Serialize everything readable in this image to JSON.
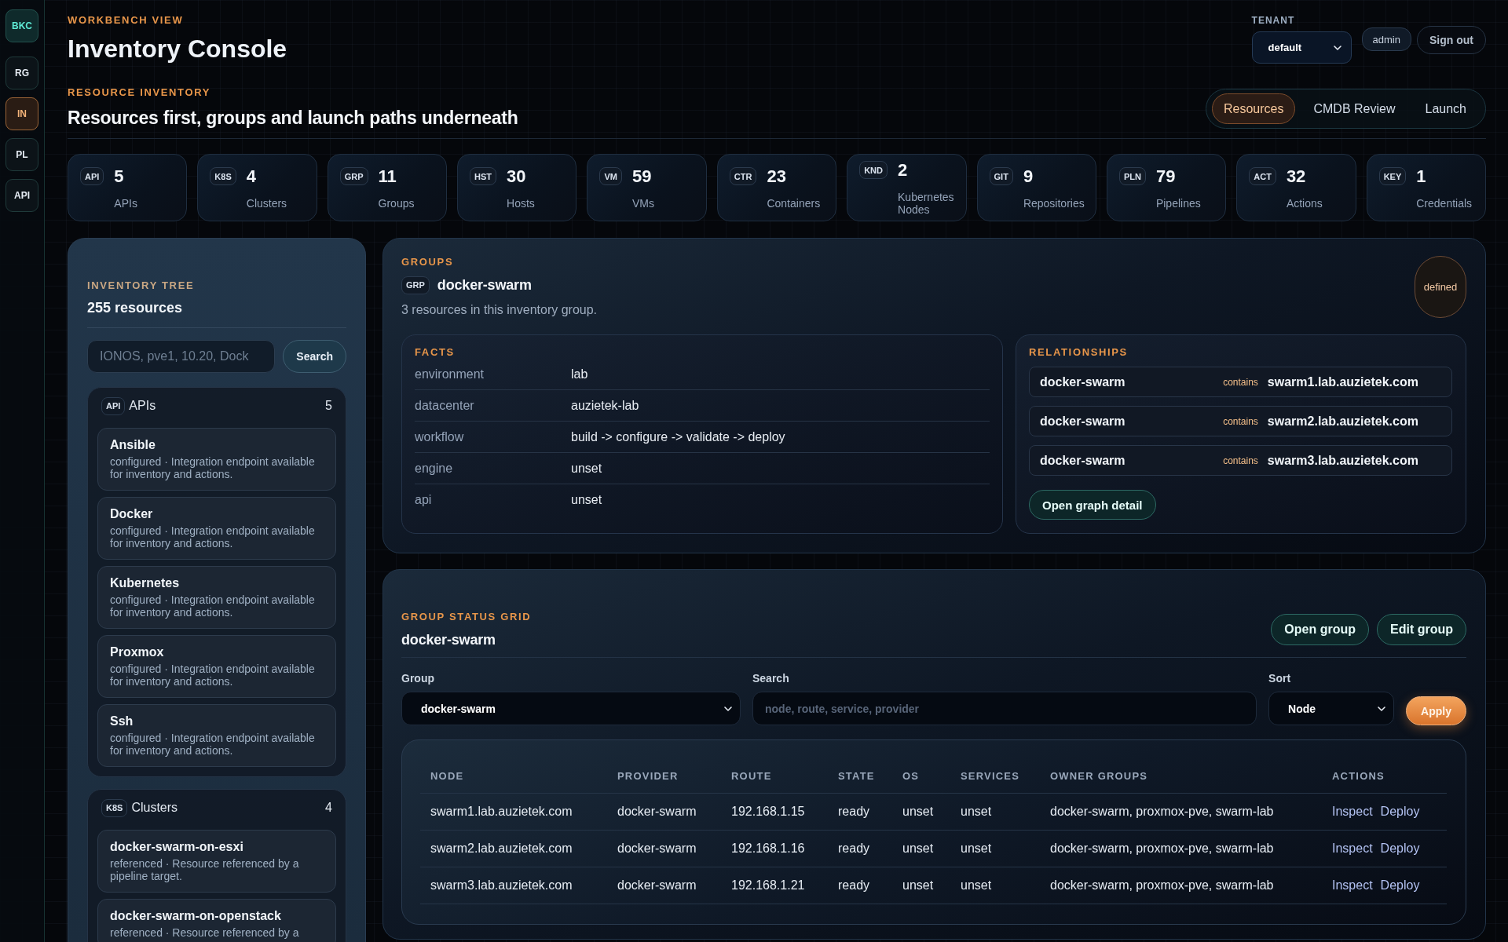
{
  "sidebar": {
    "logo": "BKC",
    "items": [
      {
        "label": "RG",
        "selected": false
      },
      {
        "label": "IN",
        "selected": true
      },
      {
        "label": "PL",
        "selected": false
      },
      {
        "label": "API",
        "selected": false
      }
    ]
  },
  "header": {
    "eyebrow": "WORKBENCH VIEW",
    "title": "Inventory Console"
  },
  "account": {
    "tenant_label": "TENANT",
    "tenant": "default",
    "user": "admin",
    "sign_out": "Sign out"
  },
  "section": {
    "eyebrow": "RESOURCE INVENTORY",
    "title": "Resources first, groups and launch paths underneath"
  },
  "tabs": [
    {
      "label": "Resources",
      "selected": true
    },
    {
      "label": "CMDB Review",
      "selected": false
    },
    {
      "label": "Launch",
      "selected": false
    }
  ],
  "stats": [
    {
      "badge": "API",
      "value": "5",
      "label": "APIs"
    },
    {
      "badge": "K8S",
      "value": "4",
      "label": "Clusters"
    },
    {
      "badge": "GRP",
      "value": "11",
      "label": "Groups"
    },
    {
      "badge": "HST",
      "value": "30",
      "label": "Hosts"
    },
    {
      "badge": "VM",
      "value": "59",
      "label": "VMs"
    },
    {
      "badge": "CTR",
      "value": "23",
      "label": "Containers"
    },
    {
      "badge": "KND",
      "value": "2",
      "label": "Kubernetes Nodes"
    },
    {
      "badge": "GIT",
      "value": "9",
      "label": "Repositories"
    },
    {
      "badge": "PLN",
      "value": "79",
      "label": "Pipelines"
    },
    {
      "badge": "ACT",
      "value": "32",
      "label": "Actions"
    },
    {
      "badge": "KEY",
      "value": "1",
      "label": "Credentials"
    }
  ],
  "inventory_tree": {
    "eyebrow": "INVENTORY TREE",
    "title": "255 resources",
    "search": {
      "placeholder": "IONOS, pve1, 10.20, Dock"
    },
    "search_button": "Search",
    "groups": [
      {
        "badge": "API",
        "name": "APIs",
        "count": "5",
        "items": [
          {
            "name": "Ansible",
            "description": "configured · Integration endpoint available for inventory and actions."
          },
          {
            "name": "Docker",
            "description": "configured · Integration endpoint available for inventory and actions."
          },
          {
            "name": "Kubernetes",
            "description": "configured · Integration endpoint available for inventory and actions."
          },
          {
            "name": "Proxmox",
            "description": "configured · Integration endpoint available for inventory and actions."
          },
          {
            "name": "Ssh",
            "description": "configured · Integration endpoint available for inventory and actions."
          }
        ]
      },
      {
        "badge": "K8S",
        "name": "Clusters",
        "count": "4",
        "items": [
          {
            "name": "docker-swarm-on-esxi",
            "description": "referenced · Resource referenced by a pipeline target."
          },
          {
            "name": "docker-swarm-on-openstack",
            "description": "referenced · Resource referenced by a"
          }
        ]
      }
    ]
  },
  "group_detail": {
    "eyebrow": "GROUPS",
    "badge": "GRP",
    "name": "docker-swarm",
    "summary": "3 resources in this inventory group.",
    "status": "defined",
    "facts": {
      "title": "FACTS",
      "rows": [
        {
          "key": "environment",
          "value": "lab"
        },
        {
          "key": "datacenter",
          "value": "auzietek-lab"
        },
        {
          "key": "workflow",
          "value": "build -> configure -> validate -> deploy"
        },
        {
          "key": "engine",
          "value": "unset"
        },
        {
          "key": "api",
          "value": "unset"
        }
      ]
    },
    "relationships": {
      "title": "RELATIONSHIPS",
      "rows": [
        {
          "from": "docker-swarm",
          "relation": "contains",
          "to": "swarm1.lab.auzietek.com"
        },
        {
          "from": "docker-swarm",
          "relation": "contains",
          "to": "swarm2.lab.auzietek.com"
        },
        {
          "from": "docker-swarm",
          "relation": "contains",
          "to": "swarm3.lab.auzietek.com"
        }
      ],
      "button": "Open graph detail"
    }
  },
  "status_grid": {
    "eyebrow": "GROUP STATUS GRID",
    "title": "docker-swarm",
    "buttons": [
      "Open group",
      "Edit group"
    ],
    "filters": {
      "group": {
        "label": "Group",
        "value": "docker-swarm"
      },
      "search": {
        "label": "Search",
        "placeholder": "node, route, service, provider"
      },
      "sort": {
        "label": "Sort",
        "value": "Node"
      },
      "apply": "Apply"
    },
    "table": {
      "columns": [
        "NODE",
        "PROVIDER",
        "ROUTE",
        "STATE",
        "OS",
        "SERVICES",
        "OWNER GROUPS",
        "ACTIONS"
      ],
      "rows": [
        {
          "cells": [
            "swarm1.lab.auzietek.com",
            "docker-swarm",
            "192.168.1.15",
            "ready",
            "unset",
            "unset",
            "docker-swarm, proxmox-pve, swarm-lab"
          ],
          "actions": [
            "Inspect",
            "Deploy"
          ]
        },
        {
          "cells": [
            "swarm2.lab.auzietek.com",
            "docker-swarm",
            "192.168.1.16",
            "ready",
            "unset",
            "unset",
            "docker-swarm, proxmox-pve, swarm-lab"
          ],
          "actions": [
            "Inspect",
            "Deploy"
          ]
        },
        {
          "cells": [
            "swarm3.lab.auzietek.com",
            "docker-swarm",
            "192.168.1.21",
            "ready",
            "unset",
            "unset",
            "docker-swarm, proxmox-pve, swarm-lab"
          ],
          "actions": [
            "Inspect",
            "Deploy"
          ]
        }
      ]
    }
  }
}
